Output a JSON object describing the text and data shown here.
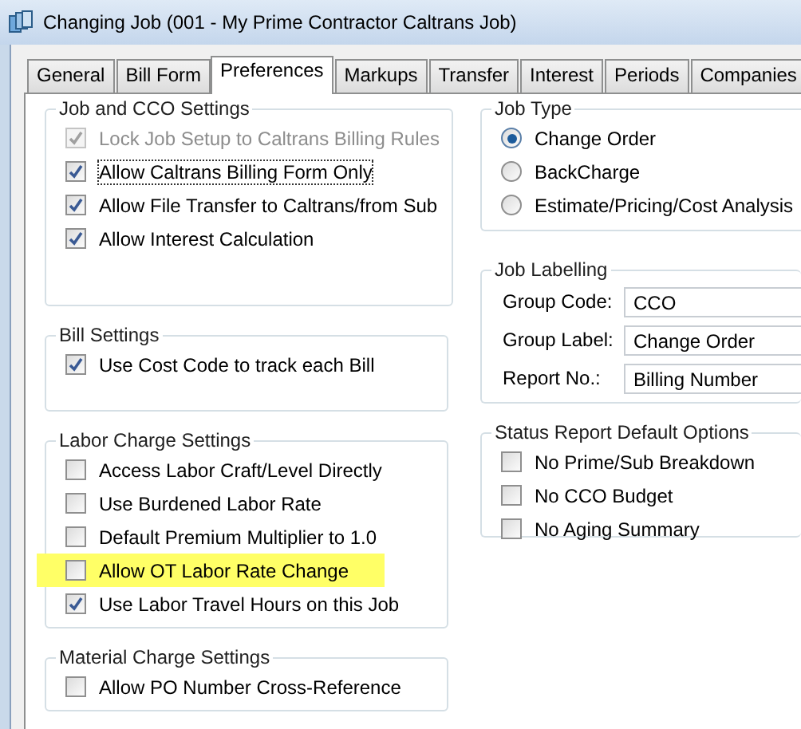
{
  "window": {
    "title": "Changing Job  (001 - My Prime Contractor Caltrans Job)"
  },
  "tabs": [
    {
      "label": "General",
      "selected": false
    },
    {
      "label": "Bill Form",
      "selected": false
    },
    {
      "label": "Preferences",
      "selected": true
    },
    {
      "label": "Markups",
      "selected": false
    },
    {
      "label": "Transfer",
      "selected": false
    },
    {
      "label": "Interest",
      "selected": false
    },
    {
      "label": "Periods",
      "selected": false
    },
    {
      "label": "Companies",
      "selected": false
    }
  ],
  "left_groups": [
    {
      "title": "Job and CCO Settings",
      "items": [
        {
          "label": "Lock Job Setup to Caltrans Billing Rules",
          "checked": true,
          "disabled": true,
          "focused": false,
          "highlighted": false
        },
        {
          "label": "Allow Caltrans Billing Form Only",
          "checked": true,
          "disabled": false,
          "focused": true,
          "highlighted": false
        },
        {
          "label": "Allow File Transfer to Caltrans/from Sub",
          "checked": true,
          "disabled": false,
          "focused": false,
          "highlighted": false
        },
        {
          "label": "Allow Interest Calculation",
          "checked": true,
          "disabled": false,
          "focused": false,
          "highlighted": false
        }
      ]
    },
    {
      "title": "Bill Settings",
      "items": [
        {
          "label": "Use Cost Code to track each Bill",
          "checked": true,
          "disabled": false,
          "focused": false,
          "highlighted": false
        }
      ]
    },
    {
      "title": "Labor Charge Settings",
      "items": [
        {
          "label": "Access Labor Craft/Level Directly",
          "checked": false,
          "disabled": false,
          "focused": false,
          "highlighted": false
        },
        {
          "label": "Use Burdened Labor Rate",
          "checked": false,
          "disabled": false,
          "focused": false,
          "highlighted": false
        },
        {
          "label": "Default Premium Multiplier to 1.0",
          "checked": false,
          "disabled": false,
          "focused": false,
          "highlighted": false
        },
        {
          "label": "Allow OT Labor Rate Change",
          "checked": false,
          "disabled": false,
          "focused": false,
          "highlighted": true
        },
        {
          "label": "Use Labor Travel Hours on this Job",
          "checked": true,
          "disabled": false,
          "focused": false,
          "highlighted": false
        }
      ]
    },
    {
      "title": "Material Charge Settings",
      "items": [
        {
          "label": "Allow PO Number Cross-Reference",
          "checked": false,
          "disabled": false,
          "focused": false,
          "highlighted": false
        }
      ]
    }
  ],
  "job_type": {
    "title": "Job Type",
    "options": [
      {
        "label": "Change Order",
        "selected": true
      },
      {
        "label": "BackCharge",
        "selected": false
      },
      {
        "label": "Estimate/Pricing/Cost Analysis",
        "selected": false
      }
    ]
  },
  "job_labelling": {
    "title": "Job Labelling",
    "fields": [
      {
        "label": "Group Code:",
        "value": "CCO"
      },
      {
        "label": "Group Label:",
        "value": "Change Order"
      },
      {
        "label": "Report No.:",
        "value": "Billing Number"
      }
    ]
  },
  "status_report": {
    "title": "Status Report Default Options",
    "items": [
      {
        "label": "No Prime/Sub Breakdown",
        "checked": false
      },
      {
        "label": "No CCO Budget",
        "checked": false
      },
      {
        "label": "No Aging Summary",
        "checked": false
      }
    ]
  }
}
